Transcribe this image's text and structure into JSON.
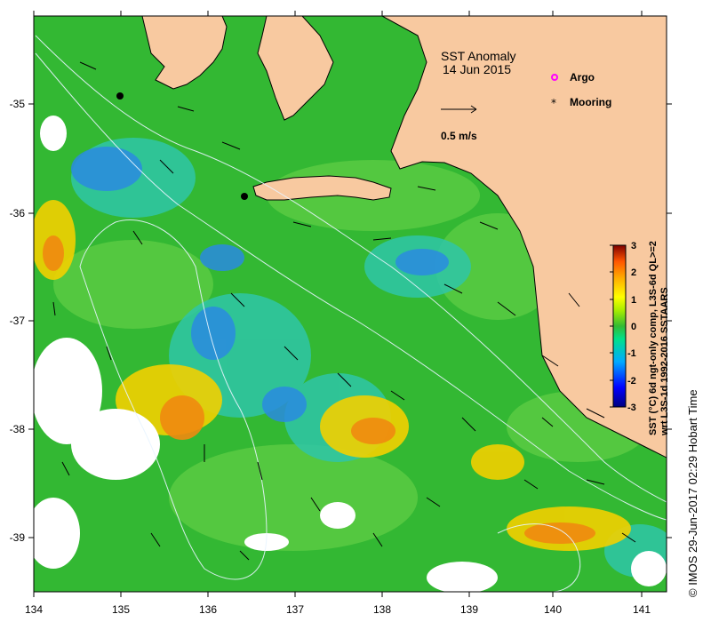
{
  "map": {
    "title": "SST Anomaly",
    "date": "14 Jun 2015",
    "legend": {
      "argo_label": "Argo",
      "mooring_label": "Mooring",
      "argo_color": "#ff00ff",
      "mooring_color": "#000000"
    },
    "velocity_scale_label": "0.5 m/s",
    "lon_ticks": [
      "134",
      "135",
      "136",
      "137",
      "138",
      "139",
      "140",
      "141"
    ],
    "lat_ticks": [
      "-35",
      "-36",
      "-37",
      "-38",
      "-39"
    ],
    "lon_range": [
      134,
      141.3
    ],
    "lat_range": [
      -39.5,
      -34.2
    ],
    "land_color": "#f8c9a0",
    "colorbar": {
      "ticks": [
        "3",
        "2",
        "1",
        "0",
        "-1",
        "-2",
        "-3"
      ],
      "range": [
        -3,
        3
      ],
      "label_line1": "SST (°C) 6d ngt-only comp, L3S-6d QL>=2",
      "label_line2": "wrt L3S-1d 1992-2016 SSTAARS",
      "colors": [
        "#00007f",
        "#0000ff",
        "#00aaff",
        "#00ffaa",
        "#22bb22",
        "#aaff00",
        "#ffff00",
        "#ffaa00",
        "#ff5500",
        "#7f0000"
      ]
    },
    "moorings": [
      {
        "lon": 135.0,
        "lat": -34.95
      },
      {
        "lon": 136.45,
        "lat": -35.85
      }
    ],
    "credit": "© IMOS 29-Jun-2017 02:29 Hobart Time"
  }
}
